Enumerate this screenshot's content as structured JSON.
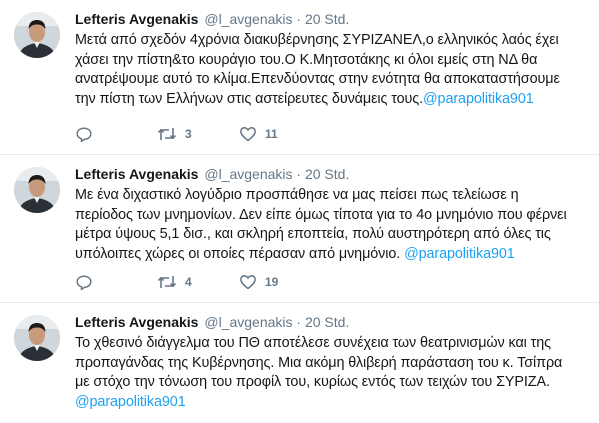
{
  "tweets": [
    {
      "author_name": "Lefteris Avgenakis",
      "handle": "@l_avgenakis",
      "separator": "·",
      "time": "20 Std.",
      "lines": [
        "Μετά από σχεδόν 4χρόνια διακυβέρνησης ΣΥΡΙΖΑΝΕΛ,ο ελληνικός λαός έχει",
        "χάσει την πίστη&το κουράγιο του.Ο Κ.Μητσοτάκης κι όλοι εμείς στη ΝΔ θα",
        "ανατρέψουμε αυτό το κλίμα.Επενδύοντας στην ενότητα θα αποκαταστήσουμε",
        "την πίστη των Ελλήνων στις αστείρευτες δυνάμεις τους."
      ],
      "mention": "@parapolitika901",
      "reply_count": "",
      "retweet_count": "3",
      "like_count": "11"
    },
    {
      "author_name": "Lefteris Avgenakis",
      "handle": "@l_avgenakis",
      "separator": "·",
      "time": "20 Std.",
      "lines": [
        "Με ένα διχαστικό λογύδριο προσπάθησε να μας πείσει πως τελείωσε η",
        "περίοδος των μνημονίων. Δεν είπε όμως τίποτα για το 4ο μνημόνιο που φέρνει",
        "μέτρα ύψους 5,1 δισ., και σκληρή εποπτεία, πολύ αυστηρότερη από όλες τις",
        "υπόλοιπες χώρες οι οποίες πέρασαν από μνημόνιο."
      ],
      "mention": "@parapolitika901",
      "reply_count": "",
      "retweet_count": "4",
      "like_count": "19"
    },
    {
      "author_name": "Lefteris Avgenakis",
      "handle": "@l_avgenakis",
      "separator": "·",
      "time": "20 Std.",
      "lines": [
        "Το χθεσινό διάγγελμα του ΠΘ αποτέλεσε συνέχεια των θεατρινισμών και της",
        "προπαγάνδας της Κυβέρνησης. Μια ακόμη θλιβερή παράσταση του κ. Τσίπρα",
        "με στόχο την τόνωση του προφίλ του, κυρίως εντός των τειχών του ΣΥΡΙΖΑ."
      ],
      "mention": "@parapolitika901"
    }
  ],
  "icons": {
    "reply": "reply-icon",
    "retweet": "retweet-icon",
    "like": "heart-icon"
  },
  "colors": {
    "text": "#14171a",
    "secondary": "#657786",
    "link": "#1da1f2",
    "divider": "#e6ecf0"
  }
}
